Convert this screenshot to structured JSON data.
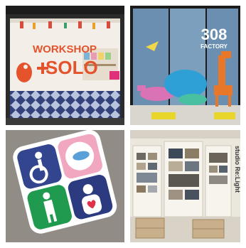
{
  "tiles": {
    "workshop": {
      "sign_line1": "WORKSHOP",
      "sign_line2": "SOLO",
      "colors": {
        "sign": "#e5532d",
        "tiles_blue": "#33427a",
        "tiles_light": "#b8c3de",
        "frame": "#2b2b2b"
      }
    },
    "factory": {
      "number": "308",
      "word": "FACTORY",
      "colors": {
        "giraffe": "#e8772a",
        "dino": "#d973b5",
        "hippo": "#2fa0d6",
        "frame": "#1c1c1c"
      }
    },
    "floor_sign": {
      "icons": [
        "wheelchair-icon",
        "baby-changing-icon",
        "ostomate-icon",
        "heart-person-icon"
      ],
      "colors": {
        "blue": "#33458f",
        "pink": "#f2a7c1",
        "green": "#1f9a4e",
        "navy": "#2c3a80"
      }
    },
    "studio": {
      "vertical_label": "studio Re:Light",
      "colors": {
        "wall": "#ece7dd",
        "crate": "#c9b08a"
      }
    }
  }
}
